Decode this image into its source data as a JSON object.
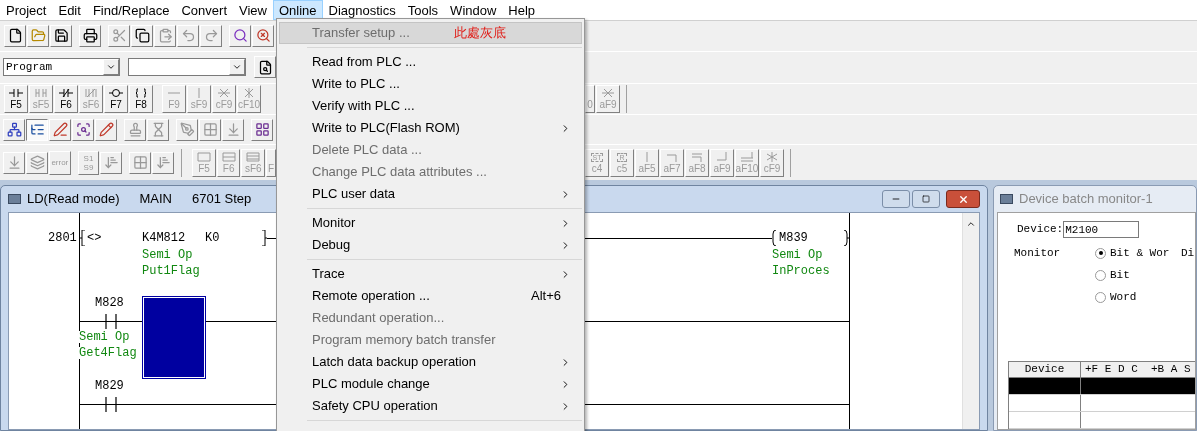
{
  "menu_bar": [
    {
      "label": "Project",
      "selected": false
    },
    {
      "label": "Edit",
      "selected": false
    },
    {
      "label": "Find/Replace",
      "selected": false
    },
    {
      "label": "Convert",
      "selected": false
    },
    {
      "label": "View",
      "selected": false
    },
    {
      "label": "Online",
      "selected": true
    },
    {
      "label": "Diagnostics",
      "selected": false
    },
    {
      "label": "Tools",
      "selected": false
    },
    {
      "label": "Window",
      "selected": false
    },
    {
      "label": "Help",
      "selected": false
    }
  ],
  "program_select": {
    "value": "Program"
  },
  "ladder_toolbar_left": [
    {
      "key": "F5",
      "kind": "contact",
      "disabled": false
    },
    {
      "key": "sF5",
      "kind": "contact-parallel",
      "disabled": true
    },
    {
      "key": "F6",
      "kind": "contact-nc",
      "disabled": false
    },
    {
      "key": "sF6",
      "kind": "contact-nc-parallel",
      "disabled": true
    },
    {
      "key": "F7",
      "kind": "coil",
      "disabled": false
    },
    {
      "key": "F8",
      "kind": "function",
      "disabled": false
    },
    {
      "key": "F9",
      "kind": "hline",
      "disabled": true
    },
    {
      "key": "sF9",
      "kind": "vline",
      "disabled": true
    },
    {
      "key": "cF9",
      "kind": "hline-delete",
      "disabled": true
    },
    {
      "key": "cF10",
      "kind": "vline-delete",
      "disabled": true
    }
  ],
  "ladder_toolbar_right": [
    {
      "key": "0",
      "kind": "partial",
      "disabled": true
    },
    {
      "key": "aF9",
      "kind": "hline-delete",
      "disabled": true
    }
  ],
  "mode_toolbar": [
    {
      "pressed": false
    },
    {
      "pressed": true
    },
    {
      "pressed": false
    },
    {
      "pressed": false
    },
    {
      "pressed": false
    },
    {
      "pressed": false
    },
    {
      "pressed": false
    },
    {
      "pressed": false
    },
    {
      "pressed": false
    },
    {
      "pressed": false
    },
    {
      "pressed": false
    }
  ],
  "edit_toolbar": [
    {
      "kind": "icon"
    },
    {
      "kind": "icon"
    },
    {
      "kind": "text",
      "lines": [
        "error"
      ]
    },
    {
      "kind": "text",
      "lines": [
        "S1",
        "S9"
      ]
    },
    {
      "kind": "icon"
    },
    {
      "kind": "icon"
    },
    {
      "kind": "icon"
    }
  ],
  "symbol_toolbar_left": [
    {
      "key": "F5",
      "kind": "box",
      "disabled": true
    },
    {
      "key": "F6",
      "kind": "box2",
      "disabled": true
    },
    {
      "key": "sF6",
      "kind": "box3",
      "disabled": true
    },
    {
      "key": "F",
      "kind": "partial",
      "disabled": true
    }
  ],
  "symbol_toolbar_right": [
    {
      "key": "c4",
      "kind": "tag",
      "symbol": "ST",
      "disabled": true
    },
    {
      "key": "c5",
      "kind": "tag",
      "symbol": "R",
      "disabled": true
    },
    {
      "key": "aF5",
      "kind": "vline",
      "disabled": true
    },
    {
      "key": "aF7",
      "kind": "corner",
      "disabled": true
    },
    {
      "key": "aF8",
      "kind": "corner-double",
      "disabled": true
    },
    {
      "key": "aF9",
      "kind": "corner-up",
      "disabled": true
    },
    {
      "key": "aF10",
      "kind": "double-line",
      "disabled": true
    },
    {
      "key": "cF9",
      "kind": "cross",
      "disabled": true
    }
  ],
  "online_menu": [
    {
      "kind": "item",
      "label": "Transfer setup ...",
      "disabled": true,
      "selected": true,
      "submenu": false,
      "annotation": "此處灰底"
    },
    {
      "kind": "separator"
    },
    {
      "kind": "item",
      "label": "Read from PLC ...",
      "disabled": false,
      "selected": false,
      "submenu": false
    },
    {
      "kind": "item",
      "label": "Write to PLC ...",
      "disabled": false,
      "selected": false,
      "submenu": false
    },
    {
      "kind": "item",
      "label": "Verify with PLC ...",
      "disabled": false,
      "selected": false,
      "submenu": false
    },
    {
      "kind": "item",
      "label": "Write to PLC(Flash ROM)",
      "disabled": false,
      "selected": false,
      "submenu": true
    },
    {
      "kind": "item",
      "label": "Delete PLC data ...",
      "disabled": true,
      "selected": false,
      "submenu": false
    },
    {
      "kind": "item",
      "label": "Change PLC data attributes ...",
      "disabled": true,
      "selected": false,
      "submenu": false
    },
    {
      "kind": "item",
      "label": "PLC user data",
      "disabled": false,
      "selected": false,
      "submenu": true
    },
    {
      "kind": "separator"
    },
    {
      "kind": "item",
      "label": "Monitor",
      "disabled": false,
      "selected": false,
      "submenu": true
    },
    {
      "kind": "item",
      "label": "Debug",
      "disabled": false,
      "selected": false,
      "submenu": true
    },
    {
      "kind": "separator"
    },
    {
      "kind": "item",
      "label": "Trace",
      "disabled": false,
      "selected": false,
      "submenu": true
    },
    {
      "kind": "item",
      "label": "Remote operation ...",
      "disabled": false,
      "selected": false,
      "submenu": false,
      "shortcut": "Alt+6"
    },
    {
      "kind": "item",
      "label": "Redundant operation...",
      "disabled": true,
      "selected": false,
      "submenu": false
    },
    {
      "kind": "item",
      "label": "Program memory batch transfer",
      "disabled": true,
      "selected": false,
      "submenu": false
    },
    {
      "kind": "item",
      "label": "Latch data backup operation",
      "disabled": false,
      "selected": false,
      "submenu": true
    },
    {
      "kind": "item",
      "label": "PLC module change",
      "disabled": false,
      "selected": false,
      "submenu": true
    },
    {
      "kind": "item",
      "label": "Safety CPU operation",
      "disabled": false,
      "selected": false,
      "submenu": true
    },
    {
      "kind": "separator"
    }
  ],
  "ld_window": {
    "title_parts": [
      "LD(Read mode)",
      "MAIN",
      "6701 Step"
    ]
  },
  "ladder": {
    "step": "2801",
    "compare": {
      "op": "<>",
      "operand1": "K4M812",
      "operand2": "K0",
      "comment": [
        "Semi Op",
        "Put1Flag"
      ]
    },
    "coil": {
      "device": "M839",
      "comment": [
        "Semi Op",
        "InProces"
      ]
    },
    "contacts": [
      {
        "device": "M828",
        "comment": [
          "Semi Op",
          "Get4Flag"
        ]
      },
      {
        "device": "M829"
      }
    ]
  },
  "device_monitor": {
    "title": "Device batch monitor-1",
    "device_label": "Device:",
    "device_value": "M2100",
    "monitor_label": "Monitor",
    "display_label": "Di",
    "monitor_options": [
      {
        "label": "Bit & Wor",
        "selected": true
      },
      {
        "label": "Bit",
        "selected": false
      },
      {
        "label": "Word",
        "selected": false
      }
    ],
    "table": {
      "columns": [
        "Device",
        "+F E D C  +B A S"
      ],
      "rows": [
        {
          "selected": true
        },
        {
          "selected": false
        },
        {
          "selected": false
        }
      ]
    }
  }
}
